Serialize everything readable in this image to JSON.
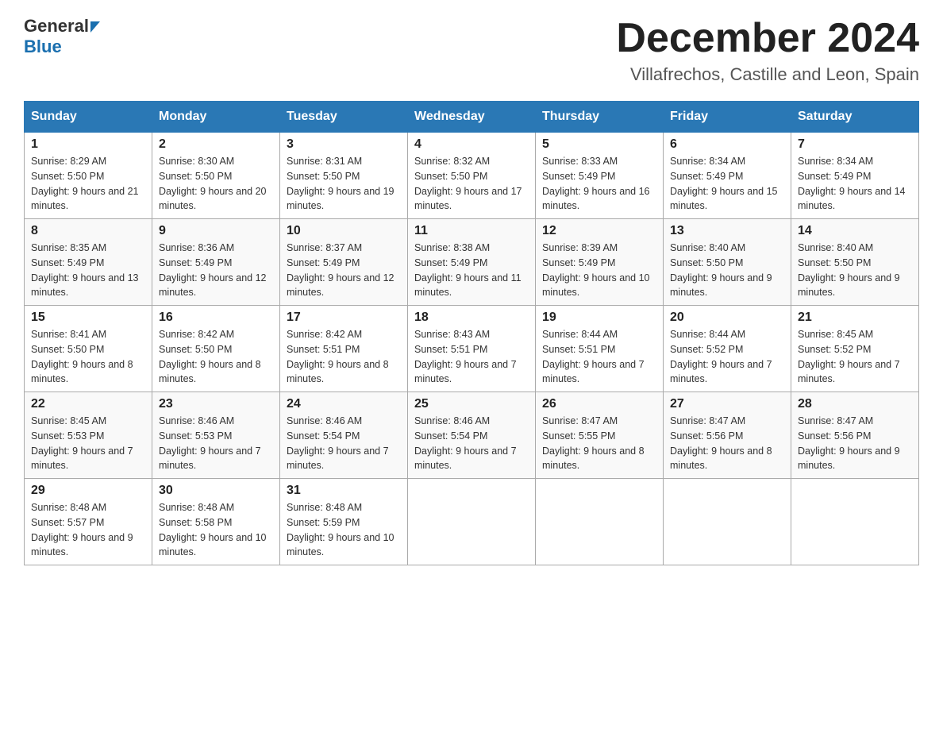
{
  "header": {
    "logo": {
      "general": "General",
      "blue": "Blue"
    },
    "title": "December 2024",
    "location": "Villafrechos, Castille and Leon, Spain"
  },
  "weekdays": [
    "Sunday",
    "Monday",
    "Tuesday",
    "Wednesday",
    "Thursday",
    "Friday",
    "Saturday"
  ],
  "weeks": [
    [
      {
        "day": "1",
        "sunrise": "8:29 AM",
        "sunset": "5:50 PM",
        "daylight": "9 hours and 21 minutes."
      },
      {
        "day": "2",
        "sunrise": "8:30 AM",
        "sunset": "5:50 PM",
        "daylight": "9 hours and 20 minutes."
      },
      {
        "day": "3",
        "sunrise": "8:31 AM",
        "sunset": "5:50 PM",
        "daylight": "9 hours and 19 minutes."
      },
      {
        "day": "4",
        "sunrise": "8:32 AM",
        "sunset": "5:50 PM",
        "daylight": "9 hours and 17 minutes."
      },
      {
        "day": "5",
        "sunrise": "8:33 AM",
        "sunset": "5:49 PM",
        "daylight": "9 hours and 16 minutes."
      },
      {
        "day": "6",
        "sunrise": "8:34 AM",
        "sunset": "5:49 PM",
        "daylight": "9 hours and 15 minutes."
      },
      {
        "day": "7",
        "sunrise": "8:34 AM",
        "sunset": "5:49 PM",
        "daylight": "9 hours and 14 minutes."
      }
    ],
    [
      {
        "day": "8",
        "sunrise": "8:35 AM",
        "sunset": "5:49 PM",
        "daylight": "9 hours and 13 minutes."
      },
      {
        "day": "9",
        "sunrise": "8:36 AM",
        "sunset": "5:49 PM",
        "daylight": "9 hours and 12 minutes."
      },
      {
        "day": "10",
        "sunrise": "8:37 AM",
        "sunset": "5:49 PM",
        "daylight": "9 hours and 12 minutes."
      },
      {
        "day": "11",
        "sunrise": "8:38 AM",
        "sunset": "5:49 PM",
        "daylight": "9 hours and 11 minutes."
      },
      {
        "day": "12",
        "sunrise": "8:39 AM",
        "sunset": "5:49 PM",
        "daylight": "9 hours and 10 minutes."
      },
      {
        "day": "13",
        "sunrise": "8:40 AM",
        "sunset": "5:50 PM",
        "daylight": "9 hours and 9 minutes."
      },
      {
        "day": "14",
        "sunrise": "8:40 AM",
        "sunset": "5:50 PM",
        "daylight": "9 hours and 9 minutes."
      }
    ],
    [
      {
        "day": "15",
        "sunrise": "8:41 AM",
        "sunset": "5:50 PM",
        "daylight": "9 hours and 8 minutes."
      },
      {
        "day": "16",
        "sunrise": "8:42 AM",
        "sunset": "5:50 PM",
        "daylight": "9 hours and 8 minutes."
      },
      {
        "day": "17",
        "sunrise": "8:42 AM",
        "sunset": "5:51 PM",
        "daylight": "9 hours and 8 minutes."
      },
      {
        "day": "18",
        "sunrise": "8:43 AM",
        "sunset": "5:51 PM",
        "daylight": "9 hours and 7 minutes."
      },
      {
        "day": "19",
        "sunrise": "8:44 AM",
        "sunset": "5:51 PM",
        "daylight": "9 hours and 7 minutes."
      },
      {
        "day": "20",
        "sunrise": "8:44 AM",
        "sunset": "5:52 PM",
        "daylight": "9 hours and 7 minutes."
      },
      {
        "day": "21",
        "sunrise": "8:45 AM",
        "sunset": "5:52 PM",
        "daylight": "9 hours and 7 minutes."
      }
    ],
    [
      {
        "day": "22",
        "sunrise": "8:45 AM",
        "sunset": "5:53 PM",
        "daylight": "9 hours and 7 minutes."
      },
      {
        "day": "23",
        "sunrise": "8:46 AM",
        "sunset": "5:53 PM",
        "daylight": "9 hours and 7 minutes."
      },
      {
        "day": "24",
        "sunrise": "8:46 AM",
        "sunset": "5:54 PM",
        "daylight": "9 hours and 7 minutes."
      },
      {
        "day": "25",
        "sunrise": "8:46 AM",
        "sunset": "5:54 PM",
        "daylight": "9 hours and 7 minutes."
      },
      {
        "day": "26",
        "sunrise": "8:47 AM",
        "sunset": "5:55 PM",
        "daylight": "9 hours and 8 minutes."
      },
      {
        "day": "27",
        "sunrise": "8:47 AM",
        "sunset": "5:56 PM",
        "daylight": "9 hours and 8 minutes."
      },
      {
        "day": "28",
        "sunrise": "8:47 AM",
        "sunset": "5:56 PM",
        "daylight": "9 hours and 9 minutes."
      }
    ],
    [
      {
        "day": "29",
        "sunrise": "8:48 AM",
        "sunset": "5:57 PM",
        "daylight": "9 hours and 9 minutes."
      },
      {
        "day": "30",
        "sunrise": "8:48 AM",
        "sunset": "5:58 PM",
        "daylight": "9 hours and 10 minutes."
      },
      {
        "day": "31",
        "sunrise": "8:48 AM",
        "sunset": "5:59 PM",
        "daylight": "9 hours and 10 minutes."
      },
      null,
      null,
      null,
      null
    ]
  ],
  "labels": {
    "sunrise": "Sunrise:",
    "sunset": "Sunset:",
    "daylight": "Daylight:"
  }
}
